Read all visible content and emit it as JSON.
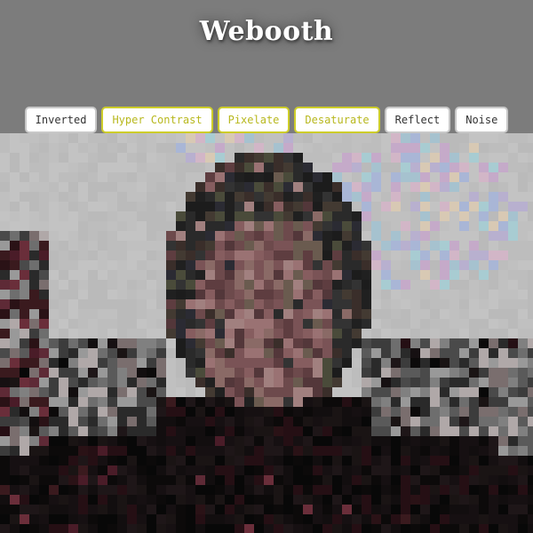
{
  "app": {
    "title": "Webooth"
  },
  "filters": [
    {
      "label": "Inverted",
      "active": false
    },
    {
      "label": "Hyper Contrast",
      "active": true
    },
    {
      "label": "Pixelate",
      "active": true
    },
    {
      "label": "Desaturate",
      "active": true
    },
    {
      "label": "Reflect",
      "active": false
    },
    {
      "label": "Noise",
      "active": false
    }
  ],
  "colors": {
    "background": "#7c7c7c",
    "active_accent": "#cdcd2a",
    "button_border": "#c8c8c8"
  }
}
